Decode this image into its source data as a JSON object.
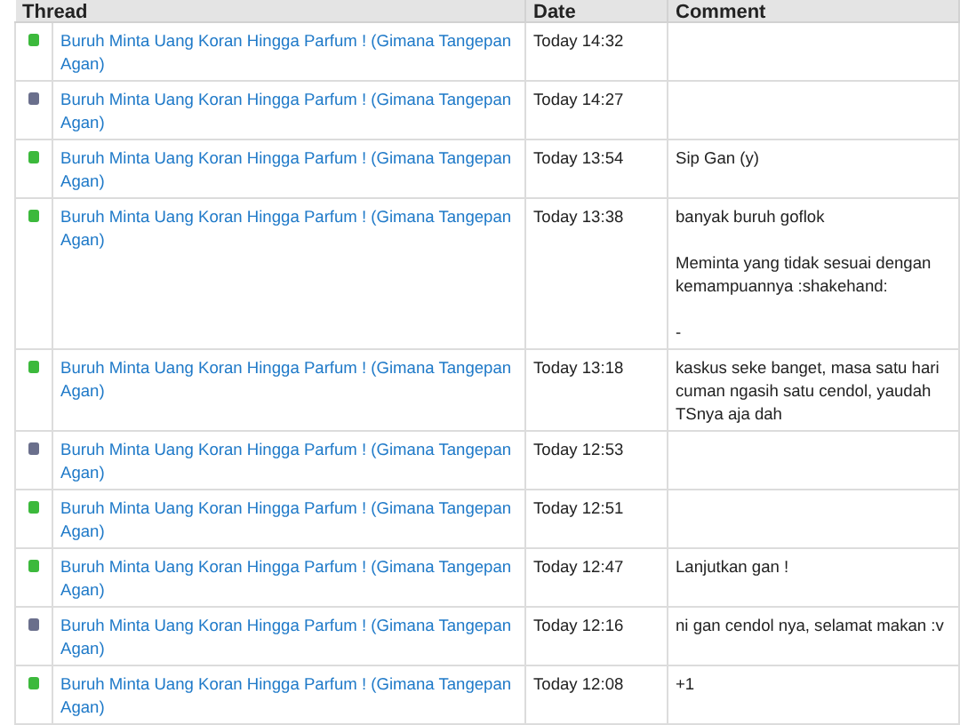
{
  "table": {
    "columns": [
      "Thread",
      "Date",
      "Comment"
    ],
    "rows": [
      {
        "color": "#3cb93c",
        "thread": "Buruh Minta Uang Koran Hingga Parfum ! (Gimana Tangepan Agan)",
        "date": "Today 14:32",
        "comment": ""
      },
      {
        "color": "#6a6f8c",
        "thread": "Buruh Minta Uang Koran Hingga Parfum ! (Gimana Tangepan Agan)",
        "date": "Today 14:27",
        "comment": ""
      },
      {
        "color": "#3cb93c",
        "thread": "Buruh Minta Uang Koran Hingga Parfum ! (Gimana Tangepan Agan)",
        "date": "Today 13:54",
        "comment": "Sip Gan (y)"
      },
      {
        "color": "#3cb93c",
        "thread": "Buruh Minta Uang Koran Hingga Parfum ! (Gimana Tangepan Agan)",
        "date": "Today 13:38",
        "comment": "banyak buruh goflok\n\nMeminta yang tidak sesuai dengan kemampuannya :shakehand:\n\n-"
      },
      {
        "color": "#3cb93c",
        "thread": "Buruh Minta Uang Koran Hingga Parfum ! (Gimana Tangepan Agan)",
        "date": "Today 13:18",
        "comment": "kaskus seke banget, masa satu hari cuman ngasih satu cendol, yaudah TSnya aja dah"
      },
      {
        "color": "#6a6f8c",
        "thread": "Buruh Minta Uang Koran Hingga Parfum ! (Gimana Tangepan Agan)",
        "date": "Today 12:53",
        "comment": ""
      },
      {
        "color": "#3cb93c",
        "thread": "Buruh Minta Uang Koran Hingga Parfum ! (Gimana Tangepan Agan)",
        "date": "Today 12:51",
        "comment": ""
      },
      {
        "color": "#3cb93c",
        "thread": "Buruh Minta Uang Koran Hingga Parfum ! (Gimana Tangepan Agan)",
        "date": "Today 12:47",
        "comment": "Lanjutkan gan !"
      },
      {
        "color": "#6a6f8c",
        "thread": "Buruh Minta Uang Koran Hingga Parfum ! (Gimana Tangepan Agan)",
        "date": "Today 12:16",
        "comment": "ni gan cendol nya, selamat makan :v"
      },
      {
        "color": "#3cb93c",
        "thread": "Buruh Minta Uang Koran Hingga Parfum ! (Gimana Tangepan Agan)",
        "date": "Today 12:08",
        "comment": "+1"
      }
    ]
  }
}
